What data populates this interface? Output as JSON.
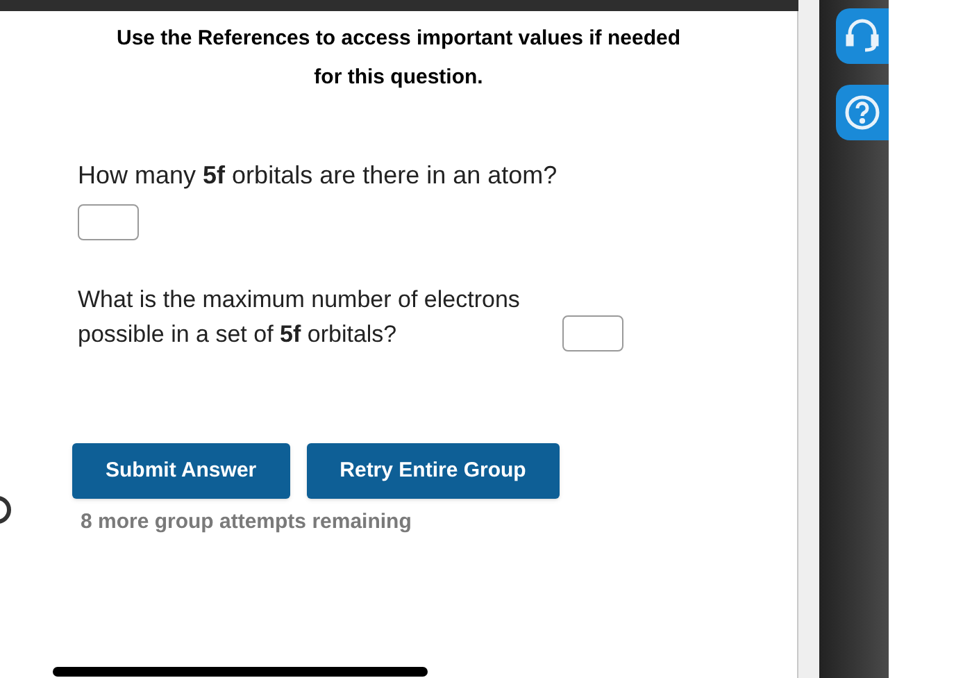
{
  "instructions": "Use the References to access important values if needed for this question.",
  "questions": [
    {
      "text": "How many **5f** orbitals are there in an atom?",
      "kind": "below"
    },
    {
      "text": "What is the maximum number of electrons possible in a set of **5f** orbitals?",
      "kind": "inline"
    }
  ],
  "buttons": [
    {
      "label": "Submit Answer"
    },
    {
      "label": "Retry Entire Group"
    }
  ],
  "attempts": "8 more group attempts remaining"
}
